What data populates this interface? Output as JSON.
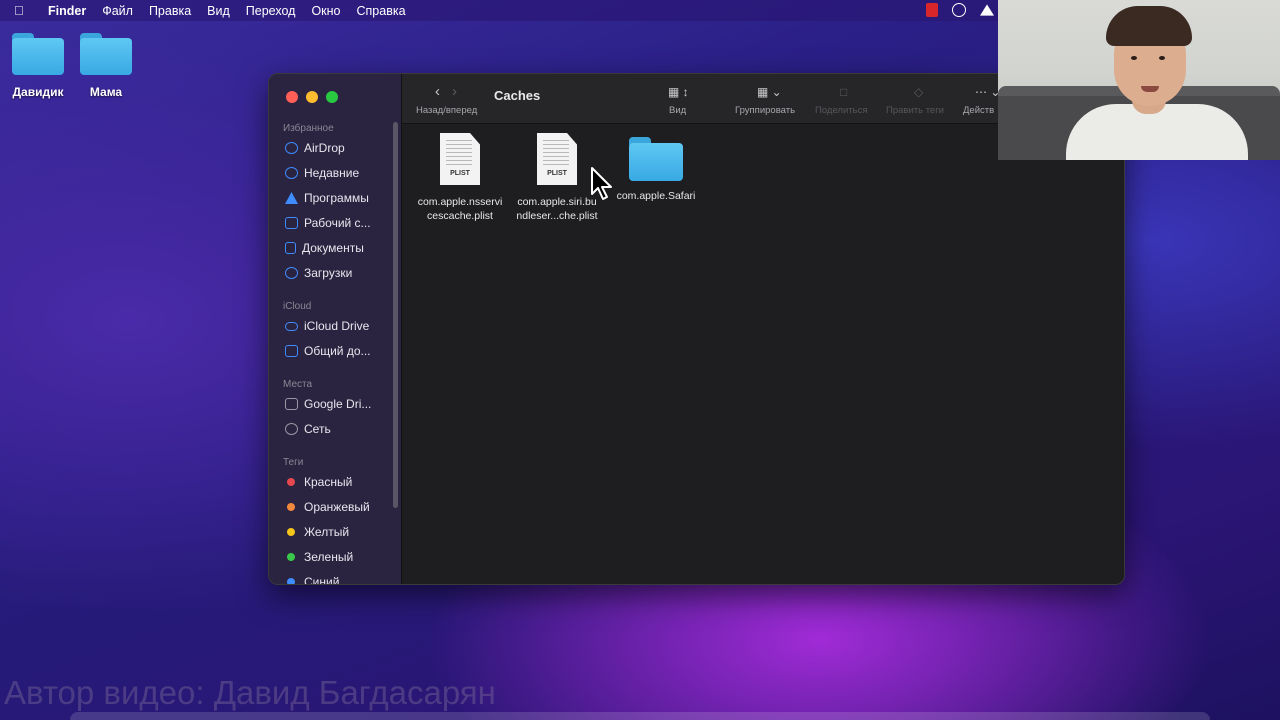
{
  "menubar": {
    "app": "Finder",
    "items": [
      "Файл",
      "Правка",
      "Вид",
      "Переход",
      "Окно",
      "Справка"
    ]
  },
  "desktop": {
    "icons": [
      "Давидик",
      "Мама"
    ]
  },
  "window": {
    "title": "Caches",
    "toolbar": {
      "nav_label": "Назад/вперед",
      "view_label": "Вид",
      "group_label": "Группировать",
      "share_label": "Поделиться",
      "tags_label": "Править теги",
      "actions_label": "Действ"
    },
    "sidebar": {
      "favorites_header": "Избранное",
      "favorites": [
        "AirDrop",
        "Недавние",
        "Программы",
        "Рабочий с...",
        "Документы",
        "Загрузки"
      ],
      "icloud_header": "iCloud",
      "icloud": [
        "iCloud Drive",
        "Общий до..."
      ],
      "places_header": "Места",
      "places": [
        "Google Dri...",
        "Сеть"
      ],
      "tags_header": "Теги",
      "tags": [
        {
          "label": "Красный",
          "color": "#e5484d"
        },
        {
          "label": "Оранжевый",
          "color": "#f0883e"
        },
        {
          "label": "Желтый",
          "color": "#f5c518"
        },
        {
          "label": "Зеленый",
          "color": "#3ac84a"
        },
        {
          "label": "Синий",
          "color": "#3f8cff"
        }
      ]
    },
    "files": [
      {
        "name_line1": "com.apple.nsservi",
        "name_line2": "cescache.plist",
        "kind": "plist",
        "tag": "PLIST"
      },
      {
        "name_line1": "com.apple.siri.bu",
        "name_line2": "ndleser...che.plist",
        "kind": "plist",
        "tag": "PLIST"
      },
      {
        "name_line1": "com.apple.Safari",
        "name_line2": "",
        "kind": "folder"
      }
    ]
  },
  "watermark": "Автор видео: Давид Багдасарян",
  "colors": {
    "accent": "#3f8cff",
    "folder": "#4bb9ee"
  }
}
